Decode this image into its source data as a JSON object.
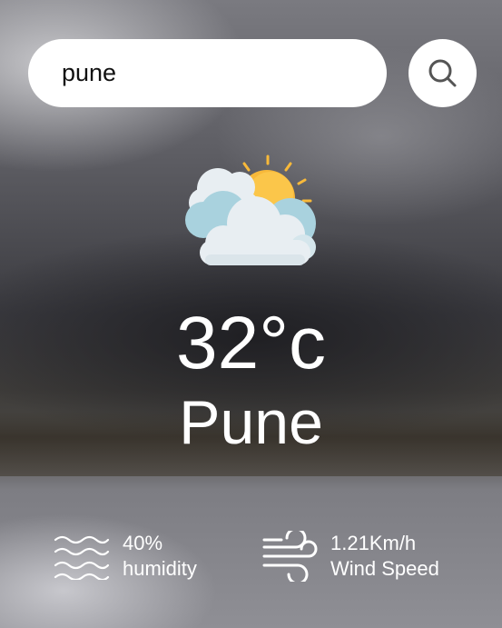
{
  "search": {
    "value": "pune"
  },
  "weather": {
    "temperature": "32°c",
    "city": "Pune",
    "icon": "sun-behind-clouds-icon"
  },
  "stats": {
    "humidity": {
      "value": "40%",
      "label": "humidity",
      "icon": "waves-icon"
    },
    "wind": {
      "value": "1.21Km/h",
      "label": "Wind Speed",
      "icon": "wind-icon"
    }
  },
  "colors": {
    "sun": "#f8b93a",
    "cloud": "#e8eef2",
    "cloud_shadow": "#a9d2de",
    "text": "#ffffff"
  }
}
